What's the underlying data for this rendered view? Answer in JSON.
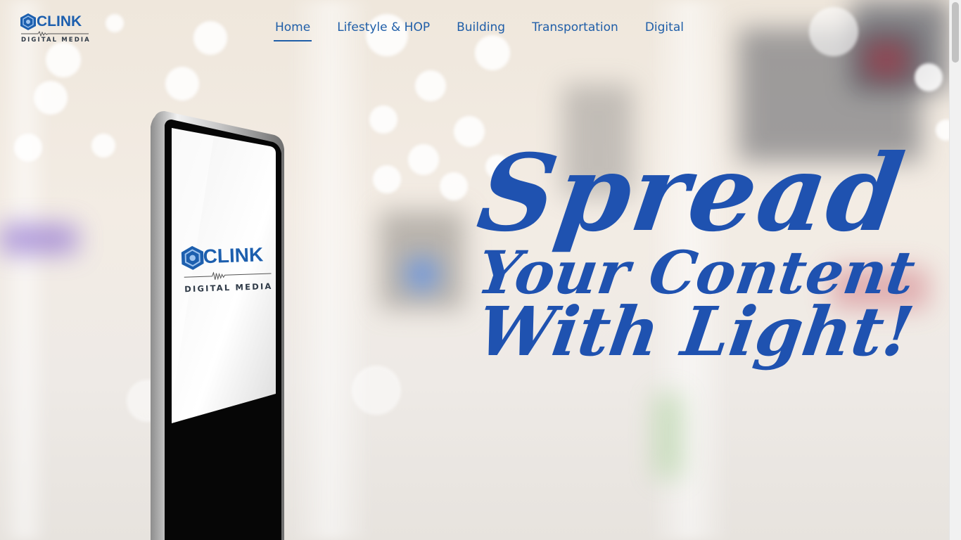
{
  "brand": {
    "name": "CLINK",
    "tagline": "DIGITAL MEDIA",
    "color": "#1d5fae"
  },
  "nav": {
    "items": [
      {
        "label": "Home",
        "active": true
      },
      {
        "label": "Lifestyle & HOP",
        "active": false
      },
      {
        "label": "Building",
        "active": false
      },
      {
        "label": "Transportation",
        "active": false
      },
      {
        "label": "Digital",
        "active": false
      }
    ],
    "color": "#1f5ea8"
  },
  "hero": {
    "headline_line1": "Spread",
    "headline_line2": "Your Content",
    "headline_line3": "With Light!",
    "headline_color": "#1f52b0"
  },
  "kiosk_screen": {
    "brand": "CLINK",
    "tagline": "DIGITAL MEDIA"
  }
}
